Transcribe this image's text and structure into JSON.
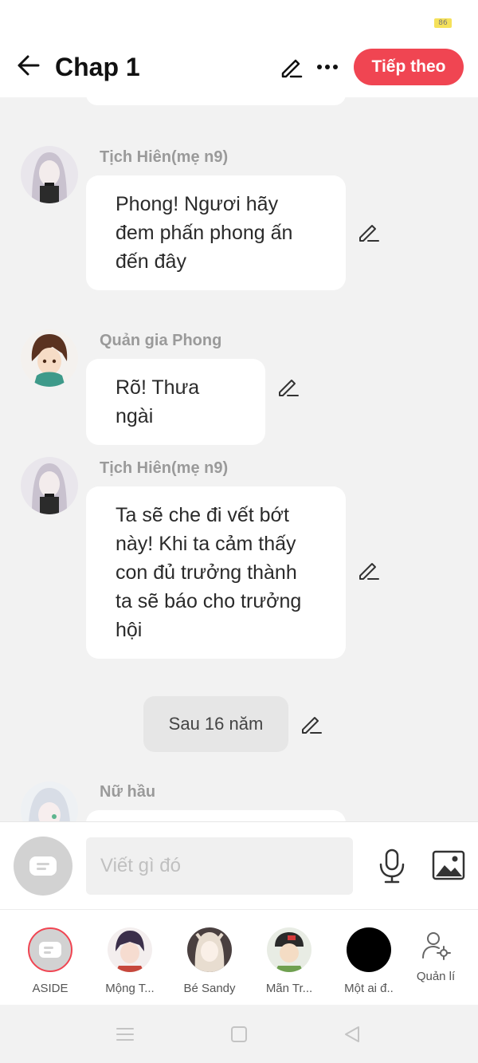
{
  "status_bar": {
    "battery": "86"
  },
  "header": {
    "title": "Chap 1",
    "next_button": "Tiếp theo"
  },
  "messages": [
    {
      "speaker": "Tịch Hiên(mẹ n9)",
      "lines": [
        "Phong! Ngươi hãy",
        "đem phấn phong ấn",
        "đến đây"
      ]
    },
    {
      "speaker": "Quản gia Phong",
      "lines": [
        "Rõ! Thưa ngài"
      ]
    },
    {
      "speaker": "Tịch Hiên(mẹ n9)",
      "lines": [
        "Ta sẽ che đi vết bớt",
        "này! Khi ta cảm thấy",
        "con đủ trưởng thành",
        "ta sẽ báo cho trưởng",
        "hội"
      ]
    },
    {
      "narration": "Sau 16 năm"
    },
    {
      "speaker": "Nữ hầu"
    }
  ],
  "composer": {
    "placeholder": "Viết gì đó"
  },
  "characters": [
    {
      "name": "ASIDE"
    },
    {
      "name": "Mộng T..."
    },
    {
      "name": "Bé Sandy"
    },
    {
      "name": "Mãn Tr..."
    },
    {
      "name": "Một ai đ.."
    }
  ],
  "manage_label": "Quản lí",
  "colors": {
    "accent": "#f04552",
    "background": "#f2f2f2",
    "bubble": "#ffffff"
  }
}
